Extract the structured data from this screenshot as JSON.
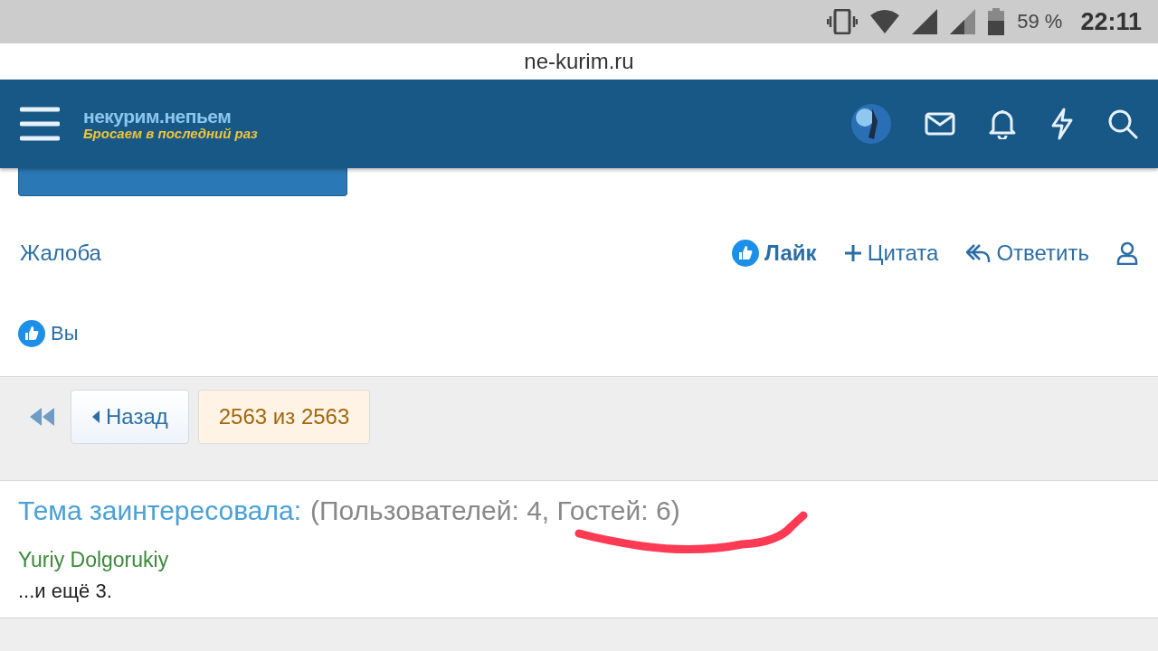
{
  "status_bar": {
    "battery": "59 %",
    "time": "22:11"
  },
  "address_bar": {
    "url": "ne-kurim.ru"
  },
  "header": {
    "logo_title": "некурим.непьем",
    "logo_tagline": "Бросаем в последний раз"
  },
  "spoiler_button": {
    "kind": "cut"
  },
  "post_actions": {
    "report": "Жалоба",
    "like": "Лайк",
    "quote": "Цитата",
    "reply": "Ответить"
  },
  "reactions": {
    "label": "Вы"
  },
  "pagination": {
    "back": "Назад",
    "page": "2563 из 2563"
  },
  "interested": {
    "title": "Тема заинтересовала:",
    "counts": "(Пользователей: 4, Гостей: 6)",
    "users": [
      {
        "name": "Yuriy Dolgorukiy"
      }
    ],
    "more": "...и ещё 3."
  }
}
